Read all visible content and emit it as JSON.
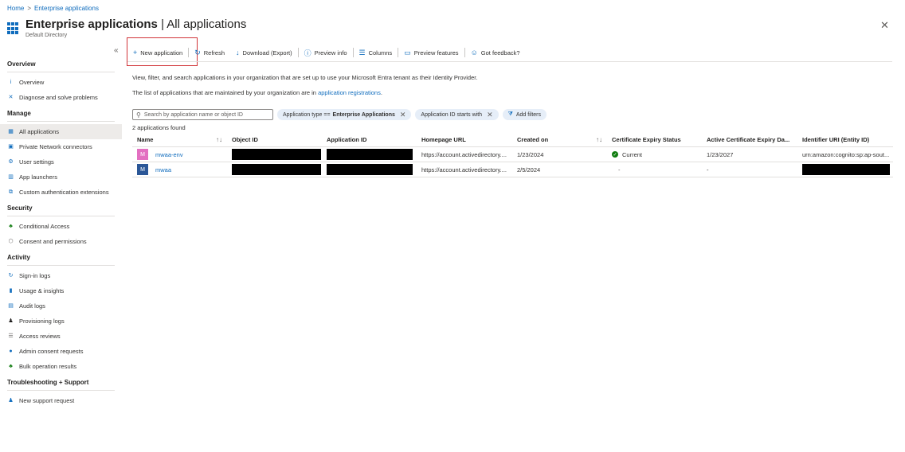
{
  "breadcrumb": {
    "home": "Home",
    "separator": ">",
    "current": "Enterprise applications"
  },
  "header": {
    "title_main": "Enterprise applications",
    "title_sub": "| All applications",
    "subtitle": "Default Directory",
    "more": "···",
    "close": "✕"
  },
  "sidebar": {
    "collapse": "«",
    "sections": [
      {
        "title": "Overview",
        "items": [
          {
            "label": "Overview",
            "icon": "info-icon",
            "glyph": "i",
            "color": "#0f6cbd"
          },
          {
            "label": "Diagnose and solve problems",
            "icon": "wrench-icon",
            "glyph": "✕",
            "color": "#0f6cbd"
          }
        ]
      },
      {
        "title": "Manage",
        "items": [
          {
            "label": "All applications",
            "icon": "grid-icon",
            "glyph": "▦",
            "color": "#0f6cbd",
            "active": true
          },
          {
            "label": "Private Network connectors",
            "icon": "connector-icon",
            "glyph": "▣",
            "color": "#0f6cbd"
          },
          {
            "label": "User settings",
            "icon": "user-settings-icon",
            "glyph": "⚙",
            "color": "#0f6cbd"
          },
          {
            "label": "App launchers",
            "icon": "app-launcher-icon",
            "glyph": "▥",
            "color": "#0f6cbd"
          },
          {
            "label": "Custom authentication extensions",
            "icon": "extension-icon",
            "glyph": "⧉",
            "color": "#0f6cbd"
          }
        ]
      },
      {
        "title": "Security",
        "items": [
          {
            "label": "Conditional Access",
            "icon": "conditional-access-icon",
            "glyph": "♣",
            "color": "#107c10"
          },
          {
            "label": "Consent and permissions",
            "icon": "permissions-icon",
            "glyph": "⬡",
            "color": "#605e5c"
          }
        ]
      },
      {
        "title": "Activity",
        "items": [
          {
            "label": "Sign-in logs",
            "icon": "sign-in-icon",
            "glyph": "↻",
            "color": "#0f6cbd"
          },
          {
            "label": "Usage & insights",
            "icon": "chart-icon",
            "glyph": "▮",
            "color": "#0f6cbd"
          },
          {
            "label": "Audit logs",
            "icon": "audit-icon",
            "glyph": "▤",
            "color": "#0f6cbd"
          },
          {
            "label": "Provisioning logs",
            "icon": "provisioning-icon",
            "glyph": "♟",
            "color": "#201f1e"
          },
          {
            "label": "Access reviews",
            "icon": "access-review-icon",
            "glyph": "☰",
            "color": "#605e5c"
          },
          {
            "label": "Admin consent requests",
            "icon": "consent-request-icon",
            "glyph": "●",
            "color": "#0f6cbd"
          },
          {
            "label": "Bulk operation results",
            "icon": "bulk-icon",
            "glyph": "♣",
            "color": "#107c10"
          }
        ]
      },
      {
        "title": "Troubleshooting + Support",
        "items": [
          {
            "label": "New support request",
            "icon": "support-icon",
            "glyph": "♟",
            "color": "#0f6cbd"
          }
        ]
      }
    ]
  },
  "toolbar": {
    "new_application": "New application",
    "refresh": "Refresh",
    "download": "Download (Export)",
    "preview_info": "Preview info",
    "columns": "Columns",
    "preview_features": "Preview features",
    "feedback": "Got feedback?"
  },
  "description": {
    "line1": "View, filter, and search applications in your organization that are set up to use your Microsoft Entra tenant as their Identity Provider.",
    "line2_prefix": "The list of applications that are maintained by your organization are in ",
    "line2_link": "application registrations",
    "line2_suffix": "."
  },
  "filters": {
    "search_placeholder": "Search by application name or object ID",
    "pill1_label": "Application type ==",
    "pill1_value": "Enterprise Applications",
    "pill2_label": "Application ID starts with",
    "add_filters": "Add filters"
  },
  "results_count": "2 applications found",
  "table": {
    "headers": {
      "name": "Name",
      "object_id": "Object ID",
      "application_id": "Application ID",
      "homepage": "Homepage URL",
      "created": "Created on",
      "cert_status": "Certificate Expiry Status",
      "active_cert": "Active Certificate Expiry Da...",
      "identifier": "Identifier URI (Entity ID)"
    },
    "rows": [
      {
        "avatar": "M",
        "avatar_color": "#e36fc1",
        "name": "mwaa-env",
        "homepage": "https://account.activedirectory....",
        "created": "1/23/2024",
        "cert_status": "Current",
        "active_cert": "1/23/2027",
        "identifier": "urn:amazon:cognito:sp:ap-sout..."
      },
      {
        "avatar": "M",
        "avatar_color": "#2b5797",
        "name": "mwaa",
        "homepage": "https://account.activedirectory....",
        "created": "2/5/2024",
        "cert_status": "-",
        "active_cert": "-"
      }
    ]
  }
}
